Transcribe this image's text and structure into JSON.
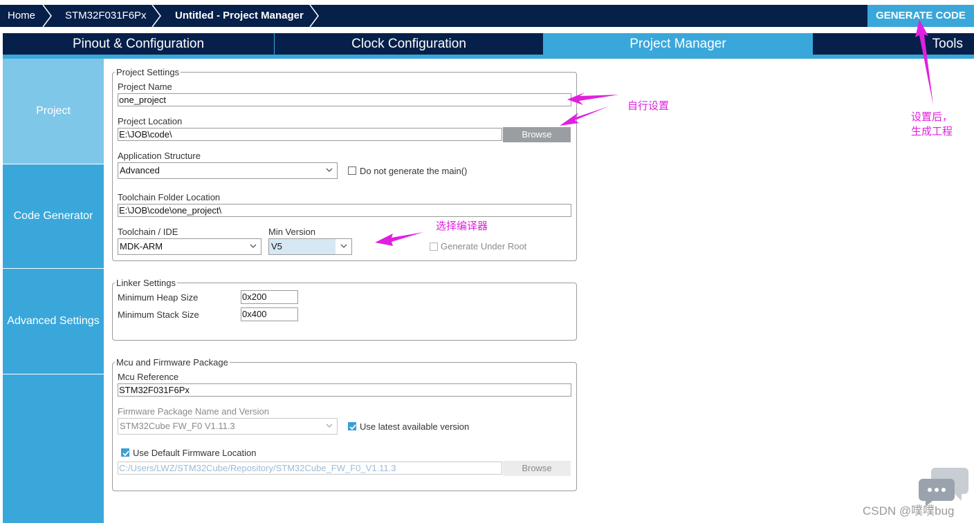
{
  "breadcrumb": {
    "home": "Home",
    "mcu": "STM32F031F6Px",
    "project": "Untitled - Project Manager"
  },
  "toolbar": {
    "generate_label": "GENERATE CODE"
  },
  "tabs": [
    {
      "label": "Pinout & Configuration"
    },
    {
      "label": "Clock Configuration"
    },
    {
      "label": "Project Manager"
    },
    {
      "label": "Tools"
    }
  ],
  "sidebar": {
    "items": [
      {
        "label": "Project"
      },
      {
        "label": "Code Generator"
      },
      {
        "label": "Advanced Settings"
      }
    ]
  },
  "project_settings": {
    "legend": "Project Settings",
    "name_label": "Project Name",
    "name_value": "one_project",
    "location_label": "Project Location",
    "location_value": "E:\\JOB\\code\\",
    "browse_label": "Browse",
    "app_structure_label": "Application Structure",
    "app_structure_value": "Advanced",
    "no_main_label": "Do not generate the main()",
    "toolchain_folder_label": "Toolchain Folder Location",
    "toolchain_folder_value": "E:\\JOB\\code\\one_project\\",
    "toolchain_label": "Toolchain / IDE",
    "toolchain_value": "MDK-ARM",
    "min_version_label": "Min Version",
    "min_version_value": "V5",
    "generate_under_root_label": "Generate Under Root"
  },
  "linker_settings": {
    "legend": "Linker Settings",
    "heap_label": "Minimum Heap Size",
    "heap_value": "0x200",
    "stack_label": "Minimum Stack Size",
    "stack_value": "0x400"
  },
  "mcu_firmware": {
    "legend": "Mcu and Firmware Package",
    "mcu_ref_label": "Mcu Reference",
    "mcu_ref_value": "STM32F031F6Px",
    "fw_label": "Firmware Package Name and Version",
    "fw_value": "STM32Cube FW_F0 V1.11.3",
    "use_latest_label": "Use latest available version",
    "use_default_label": "Use Default Firmware Location",
    "fw_location_value": "C:/Users/LWZ/STM32Cube/Repository/STM32Cube_FW_F0_V1.11.3",
    "browse_label": "Browse"
  },
  "annotations": {
    "self_setting": "自行设置",
    "choose_compiler": "选择编译器",
    "after_setting_line1": "设置后，",
    "after_setting_line2": "生成工程",
    "watermark": "CSDN @噗噗bug"
  },
  "colors": {
    "navy": "#07204a",
    "accent": "#3aa7db",
    "annotation": "#e020e0"
  }
}
